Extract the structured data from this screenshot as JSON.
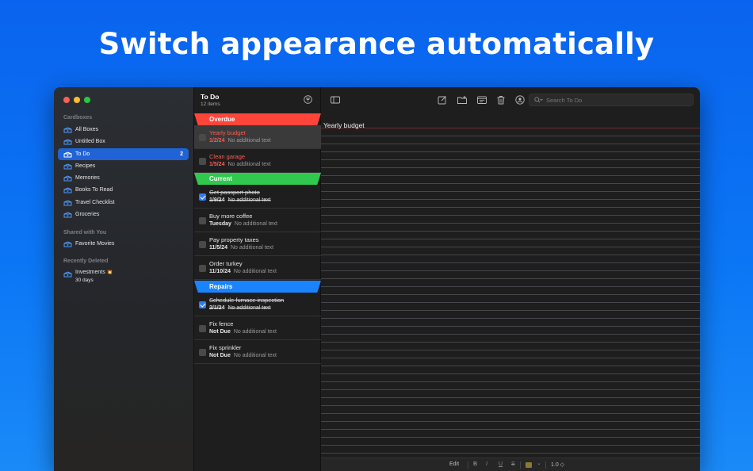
{
  "headline": "Switch appearance automatically",
  "sidebar": {
    "section_cardboxes": "Cardboxes",
    "items": [
      {
        "label": "All Boxes",
        "count": ""
      },
      {
        "label": "Untitled Box",
        "count": ""
      },
      {
        "label": "To Do",
        "count": "2"
      },
      {
        "label": "Recipes",
        "count": ""
      },
      {
        "label": "Memories",
        "count": ""
      },
      {
        "label": "Books To Read",
        "count": ""
      },
      {
        "label": "Travel Checklist",
        "count": ""
      },
      {
        "label": "Groceries",
        "count": ""
      }
    ],
    "section_shared": "Shared with You",
    "shared_items": [
      {
        "label": "Favorite Movies"
      }
    ],
    "section_deleted": "Recently Deleted",
    "deleted_items": [
      {
        "label": "Investments",
        "badge": "💥",
        "sub": "30 days"
      }
    ]
  },
  "list": {
    "title": "To Do",
    "count": "12 items",
    "sections": {
      "overdue": {
        "label": "Overdue",
        "color": "#ff453a"
      },
      "current": {
        "label": "Current",
        "color": "#30c94e"
      },
      "repairs": {
        "label": "Repairs",
        "color": "#1a84ff"
      }
    },
    "rows": [
      {
        "title": "Yearly budget",
        "date": "1/2/24",
        "note": "No additional text"
      },
      {
        "title": "Clean garage",
        "date": "1/5/24",
        "note": "No additional text"
      },
      {
        "title": "Get passport photo",
        "date": "1/9/24",
        "note": "No additional text"
      },
      {
        "title": "Buy more coffee",
        "date": "Tuesday",
        "note": "No additional text"
      },
      {
        "title": "Pay property taxes",
        "date": "11/5/24",
        "note": "No additional text"
      },
      {
        "title": "Order turkey",
        "date": "11/10/24",
        "note": "No additional text"
      },
      {
        "title": "Schedule furnace inspection",
        "date": "2/1/24",
        "note": "No additional text"
      },
      {
        "title": "Fix fence",
        "date": "Not Due",
        "note": "No additional text"
      },
      {
        "title": "Fix sprinkler",
        "date": "Not Due",
        "note": "No additional text"
      }
    ]
  },
  "detail": {
    "search_placeholder": "Search To Do",
    "note_title": "Yearly budget",
    "bottombar": {
      "edit": "Edit",
      "bold": "B",
      "italic": "I",
      "underline": "U",
      "strike": "S",
      "color_chevron": "⌄",
      "line_spacing": "1.0 ◇"
    }
  }
}
